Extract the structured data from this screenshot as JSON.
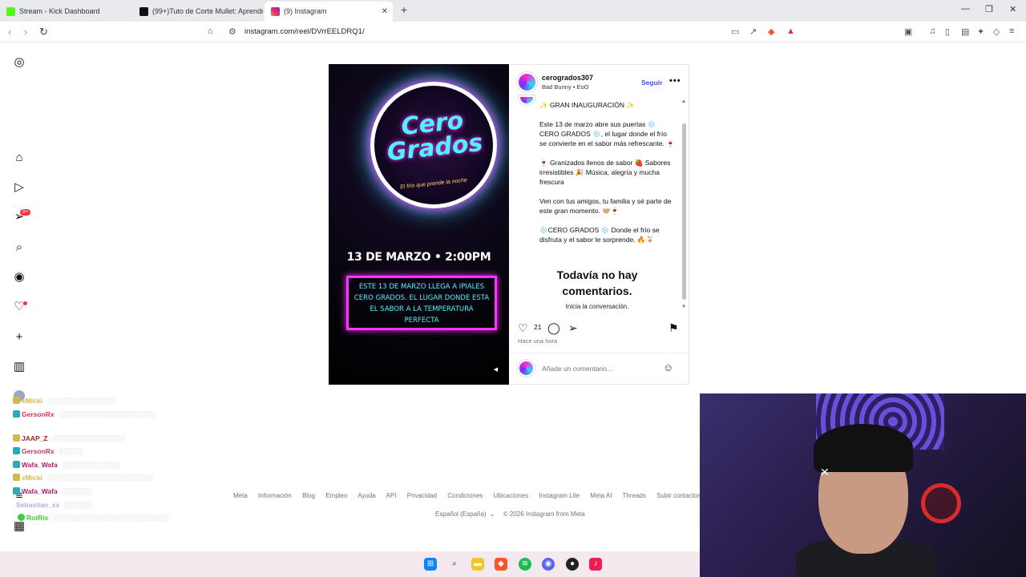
{
  "browser": {
    "tabs": [
      {
        "label": "Stream - Kick Dashboard",
        "color": "#53fc18"
      },
      {
        "label": "(99+)Tuto de Corte Mullet: Aprendr",
        "color": "#111111"
      },
      {
        "label": "(9) Instagram",
        "color": "#e1306c"
      }
    ],
    "new_tab": "+",
    "url": "instagram.com/reel/DVrrEELDRQ1/"
  },
  "nav": {
    "notif_badge": "9+"
  },
  "reel": {
    "logo_line1": "Cero",
    "logo_line2": "Grados",
    "logo_tagline": "El frío que prende la noche",
    "date_line": "13 DE MARZO • 2:00PM",
    "box_text": "ESTE 13 DE MARZO LLEGA A IPIALES CERO GRADOS. EL LUGAR DONDE ESTA EL SABOR A LA TEMPERATURA PERFECTA"
  },
  "post": {
    "username": "cerogrados307",
    "subtitle": "Bad Bunny • EoO",
    "follow_label": "Seguir",
    "more_label": "•••",
    "caption": [
      "✨ GRAN INAUGURACIÓN ✨",
      "Este 13 de marzo abre sus puertas ❄️ CERO GRADOS ❄️, el lugar donde el frío se convierte en el sabor más refrescante. 🍷",
      "🍷 Granizados llenos de sabor 🍓 Sabores irresistibles 🎉 Música, alegría y mucha frescura",
      "Ven con tus amigos, tu familia y sé parte de este gran momento. 🤝🏼🍷",
      "❄️CERO GRADOS ❄️ Donde el frío se disfruta y el sabor te sorprende. 🔥🍹"
    ],
    "no_comments_title": "Todavía no hay comentarios.",
    "no_comments_sub": "Inicia la conversación.",
    "likes": "21",
    "time": "Hace una hora",
    "comment_placeholder": "Añade un comentario..."
  },
  "footer": {
    "links": [
      "Meta",
      "Información",
      "Blog",
      "Empleo",
      "Ayuda",
      "API",
      "Privacidad",
      "Condiciones",
      "Ubicaciones",
      "Instagram Lite",
      "Meta AI",
      "Threads",
      "Subir contactos y persona"
    ],
    "language": "Español (España)",
    "copyright": "© 2026 Instagram from Meta"
  },
  "chat": [
    {
      "name": "xMicki",
      "color": "#d6b84a"
    },
    {
      "name": "GersonRx",
      "color": "#d6335a"
    },
    {
      "name": "JAAP_Z",
      "color": "#a52424"
    },
    {
      "name": "GersonRx",
      "color": "#d6335a"
    },
    {
      "name": "Wafa_Wafa",
      "color": "#b51e6a"
    },
    {
      "name": "xMicki",
      "color": "#d6b84a"
    },
    {
      "name": "Wafa_Wafa",
      "color": "#b51e6a"
    },
    {
      "name": "Sebastian_xx",
      "color": "#b9a7e8"
    },
    {
      "name": "RotRix",
      "color": "#3bd13b"
    }
  ]
}
